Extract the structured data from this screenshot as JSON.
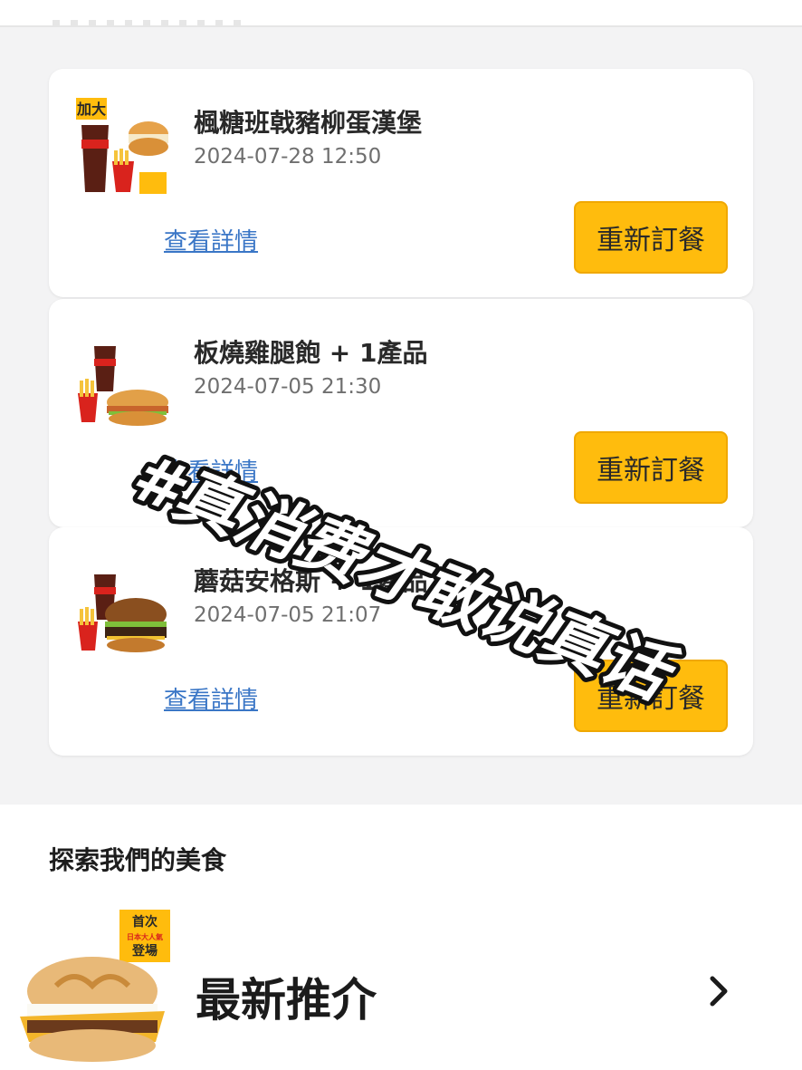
{
  "orders": [
    {
      "title": "楓糖班戟豬柳蛋漢堡",
      "date": "2024-07-28 12:50",
      "detail_label": "查看詳情",
      "reorder_label": "重新訂餐",
      "badge": "加大"
    },
    {
      "title": "板燒雞腿飽 + 1產品",
      "date": "2024-07-05 21:30",
      "detail_label": "查看詳情",
      "reorder_label": "重新訂餐",
      "badge": ""
    },
    {
      "title": "蘑菇安格斯 + 1產品",
      "date": "2024-07-05 21:07",
      "detail_label": "查看詳情",
      "reorder_label": "重新訂餐",
      "badge": ""
    }
  ],
  "explore": {
    "title": "探索我們的美食",
    "recommend_label": "最新推介",
    "badge_line1": "首次",
    "badge_line2": "日本大人氣",
    "badge_line3": "登場"
  },
  "overlay_text": "#真消费才敢说真话",
  "colors": {
    "accent": "#ffbc0d",
    "link": "#3a76c6",
    "background": "#f3f3f4"
  }
}
